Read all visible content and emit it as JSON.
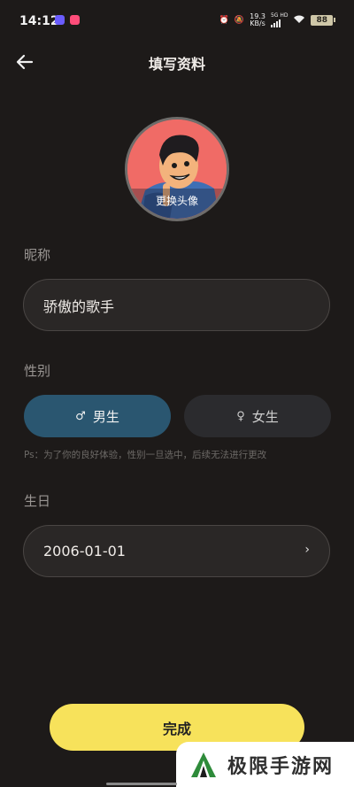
{
  "status_bar": {
    "time": "14:12",
    "net_speed": "19.3",
    "net_unit": "KB/s",
    "network": "5G HD",
    "battery": "88"
  },
  "header": {
    "title": "填写资料"
  },
  "avatar": {
    "label": "更换头像"
  },
  "nickname": {
    "label": "昵称",
    "value": "骄傲的歌手"
  },
  "gender": {
    "label": "性别",
    "male_symbol": "♂",
    "male": "男生",
    "female_symbol": "♀",
    "female": "女生",
    "selected": "male",
    "note": "Ps：为了你的良好体验，性别一旦选中，后续无法进行更改"
  },
  "birthday": {
    "label": "生日",
    "value": "2006-01-01",
    "chevron": "›"
  },
  "actions": {
    "done": "完成"
  },
  "watermark": {
    "text": "极限手游网"
  },
  "colors": {
    "accent": "#f7e25b",
    "male_selected": "#2a5670"
  }
}
